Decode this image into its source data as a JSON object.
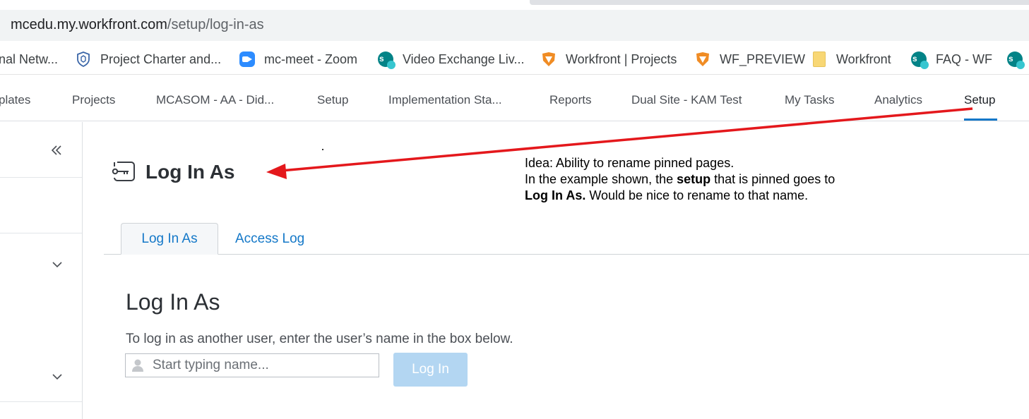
{
  "browser": {
    "url_host": "mcedu.my.workfront.com",
    "url_path": "/setup/log-in-as"
  },
  "bookmarks": [
    {
      "label": "nal Netw...",
      "icon": "none"
    },
    {
      "label": "Project Charter and...",
      "icon": "shield-icon"
    },
    {
      "label": "mc-meet - Zoom",
      "icon": "zoom-icon"
    },
    {
      "label": "Video Exchange Liv...",
      "icon": "sharepoint-icon"
    },
    {
      "label": "Workfront | Projects",
      "icon": "workfront-icon"
    },
    {
      "label": "WF_PREVIEW",
      "icon": "workfront-icon"
    },
    {
      "label": "Workfront",
      "icon": "folder-icon"
    },
    {
      "label": "FAQ - WF",
      "icon": "sharepoint-icon"
    }
  ],
  "nav": {
    "items": [
      "plates",
      "Projects",
      "MCASOM - AA - Did...",
      "Setup",
      "Implementation Sta...",
      "Reports",
      "Dual Site - KAM Test",
      "My Tasks",
      "Analytics",
      "Setup"
    ],
    "active_index": 9
  },
  "page": {
    "title": "Log In As",
    "tabs": [
      "Log In As",
      "Access Log"
    ],
    "active_tab": 0,
    "section_title": "Log In As",
    "instructions": "To log in as another user, enter the user’s name in the box below.",
    "name_placeholder": "Start typing name...",
    "login_label": "Log In"
  },
  "annotation": {
    "line1": "Idea: Ability to rename pinned pages.",
    "line2_pre": "In the example shown, the ",
    "line2_bold": "setup",
    "line2_post": " that is pinned goes to",
    "line3_bold": "Log In As.",
    "line3_post": " Would be nice to rename to that name."
  },
  "colors": {
    "accent": "#1478c8",
    "arrow": "#e4181c",
    "button_disabled": "#b3d6f2"
  }
}
